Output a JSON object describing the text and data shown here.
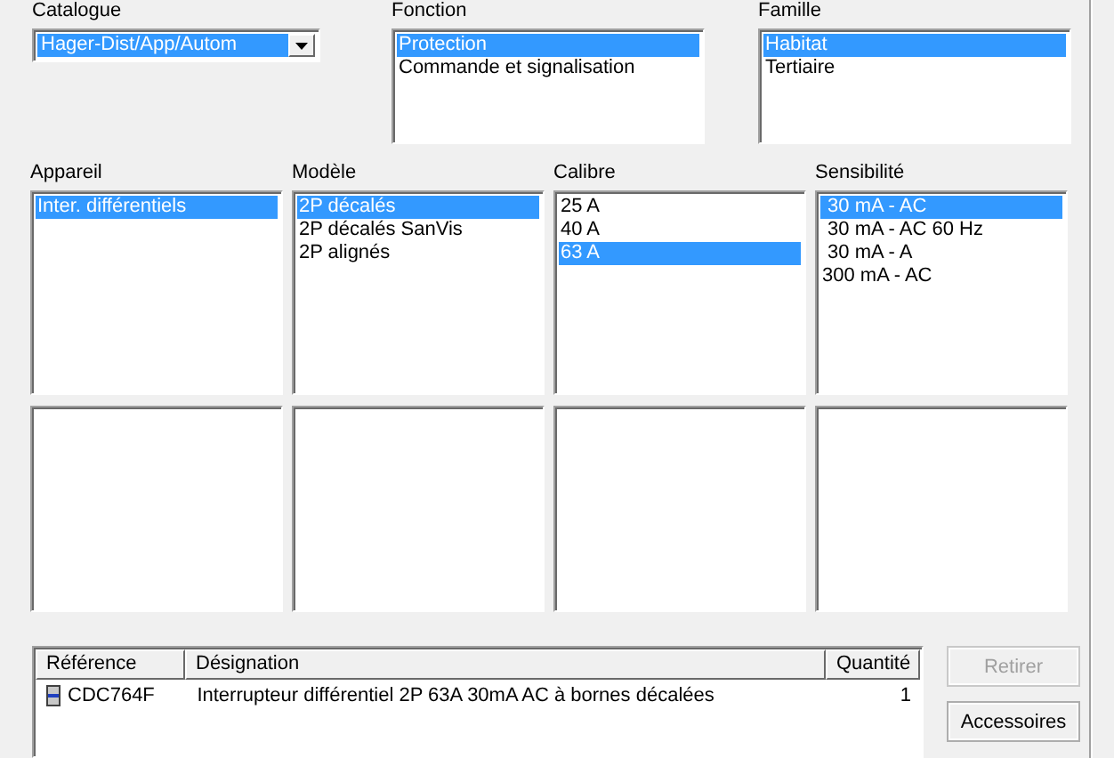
{
  "catalogue": {
    "label": "Catalogue",
    "value": "Hager-Dist/App/Autom"
  },
  "top_lists": [
    {
      "label": "Fonction",
      "items": [
        {
          "text": "Protection",
          "selected": true
        },
        {
          "text": "Commande et signalisation",
          "selected": false
        }
      ]
    },
    {
      "label": "Famille",
      "items": [
        {
          "text": "Habitat",
          "selected": true
        },
        {
          "text": "Tertiaire",
          "selected": false
        }
      ]
    }
  ],
  "filter_lists": [
    {
      "label": "Appareil",
      "items": [
        {
          "text": "Inter. différentiels",
          "selected": true
        }
      ]
    },
    {
      "label": "Modèle",
      "items": [
        {
          "text": "2P décalés",
          "selected": true
        },
        {
          "text": "2P décalés SanVis",
          "selected": false
        },
        {
          "text": "2P alignés",
          "selected": false
        }
      ]
    },
    {
      "label": "Calibre",
      "items": [
        {
          "text": "25 A",
          "selected": false
        },
        {
          "text": "40 A",
          "selected": false
        },
        {
          "text": "63 A",
          "selected": true
        }
      ]
    },
    {
      "label": "Sensibilité",
      "items": [
        {
          "text": " 30 mA - AC",
          "selected": true
        },
        {
          "text": " 30 mA - AC 60 Hz",
          "selected": false
        },
        {
          "text": " 30 mA - A",
          "selected": false
        },
        {
          "text": "300 mA - AC",
          "selected": false
        }
      ]
    }
  ],
  "table": {
    "columns": [
      "Référence",
      "Désignation",
      "Quantité"
    ],
    "rows": [
      {
        "reference": "CDC764F",
        "designation": "Interrupteur différentiel 2P 63A 30mA AC à bornes décalées",
        "quantity": "1"
      }
    ]
  },
  "buttons": [
    {
      "label": "Retirer",
      "disabled": true
    },
    {
      "label": "Accessoires",
      "disabled": false
    }
  ]
}
